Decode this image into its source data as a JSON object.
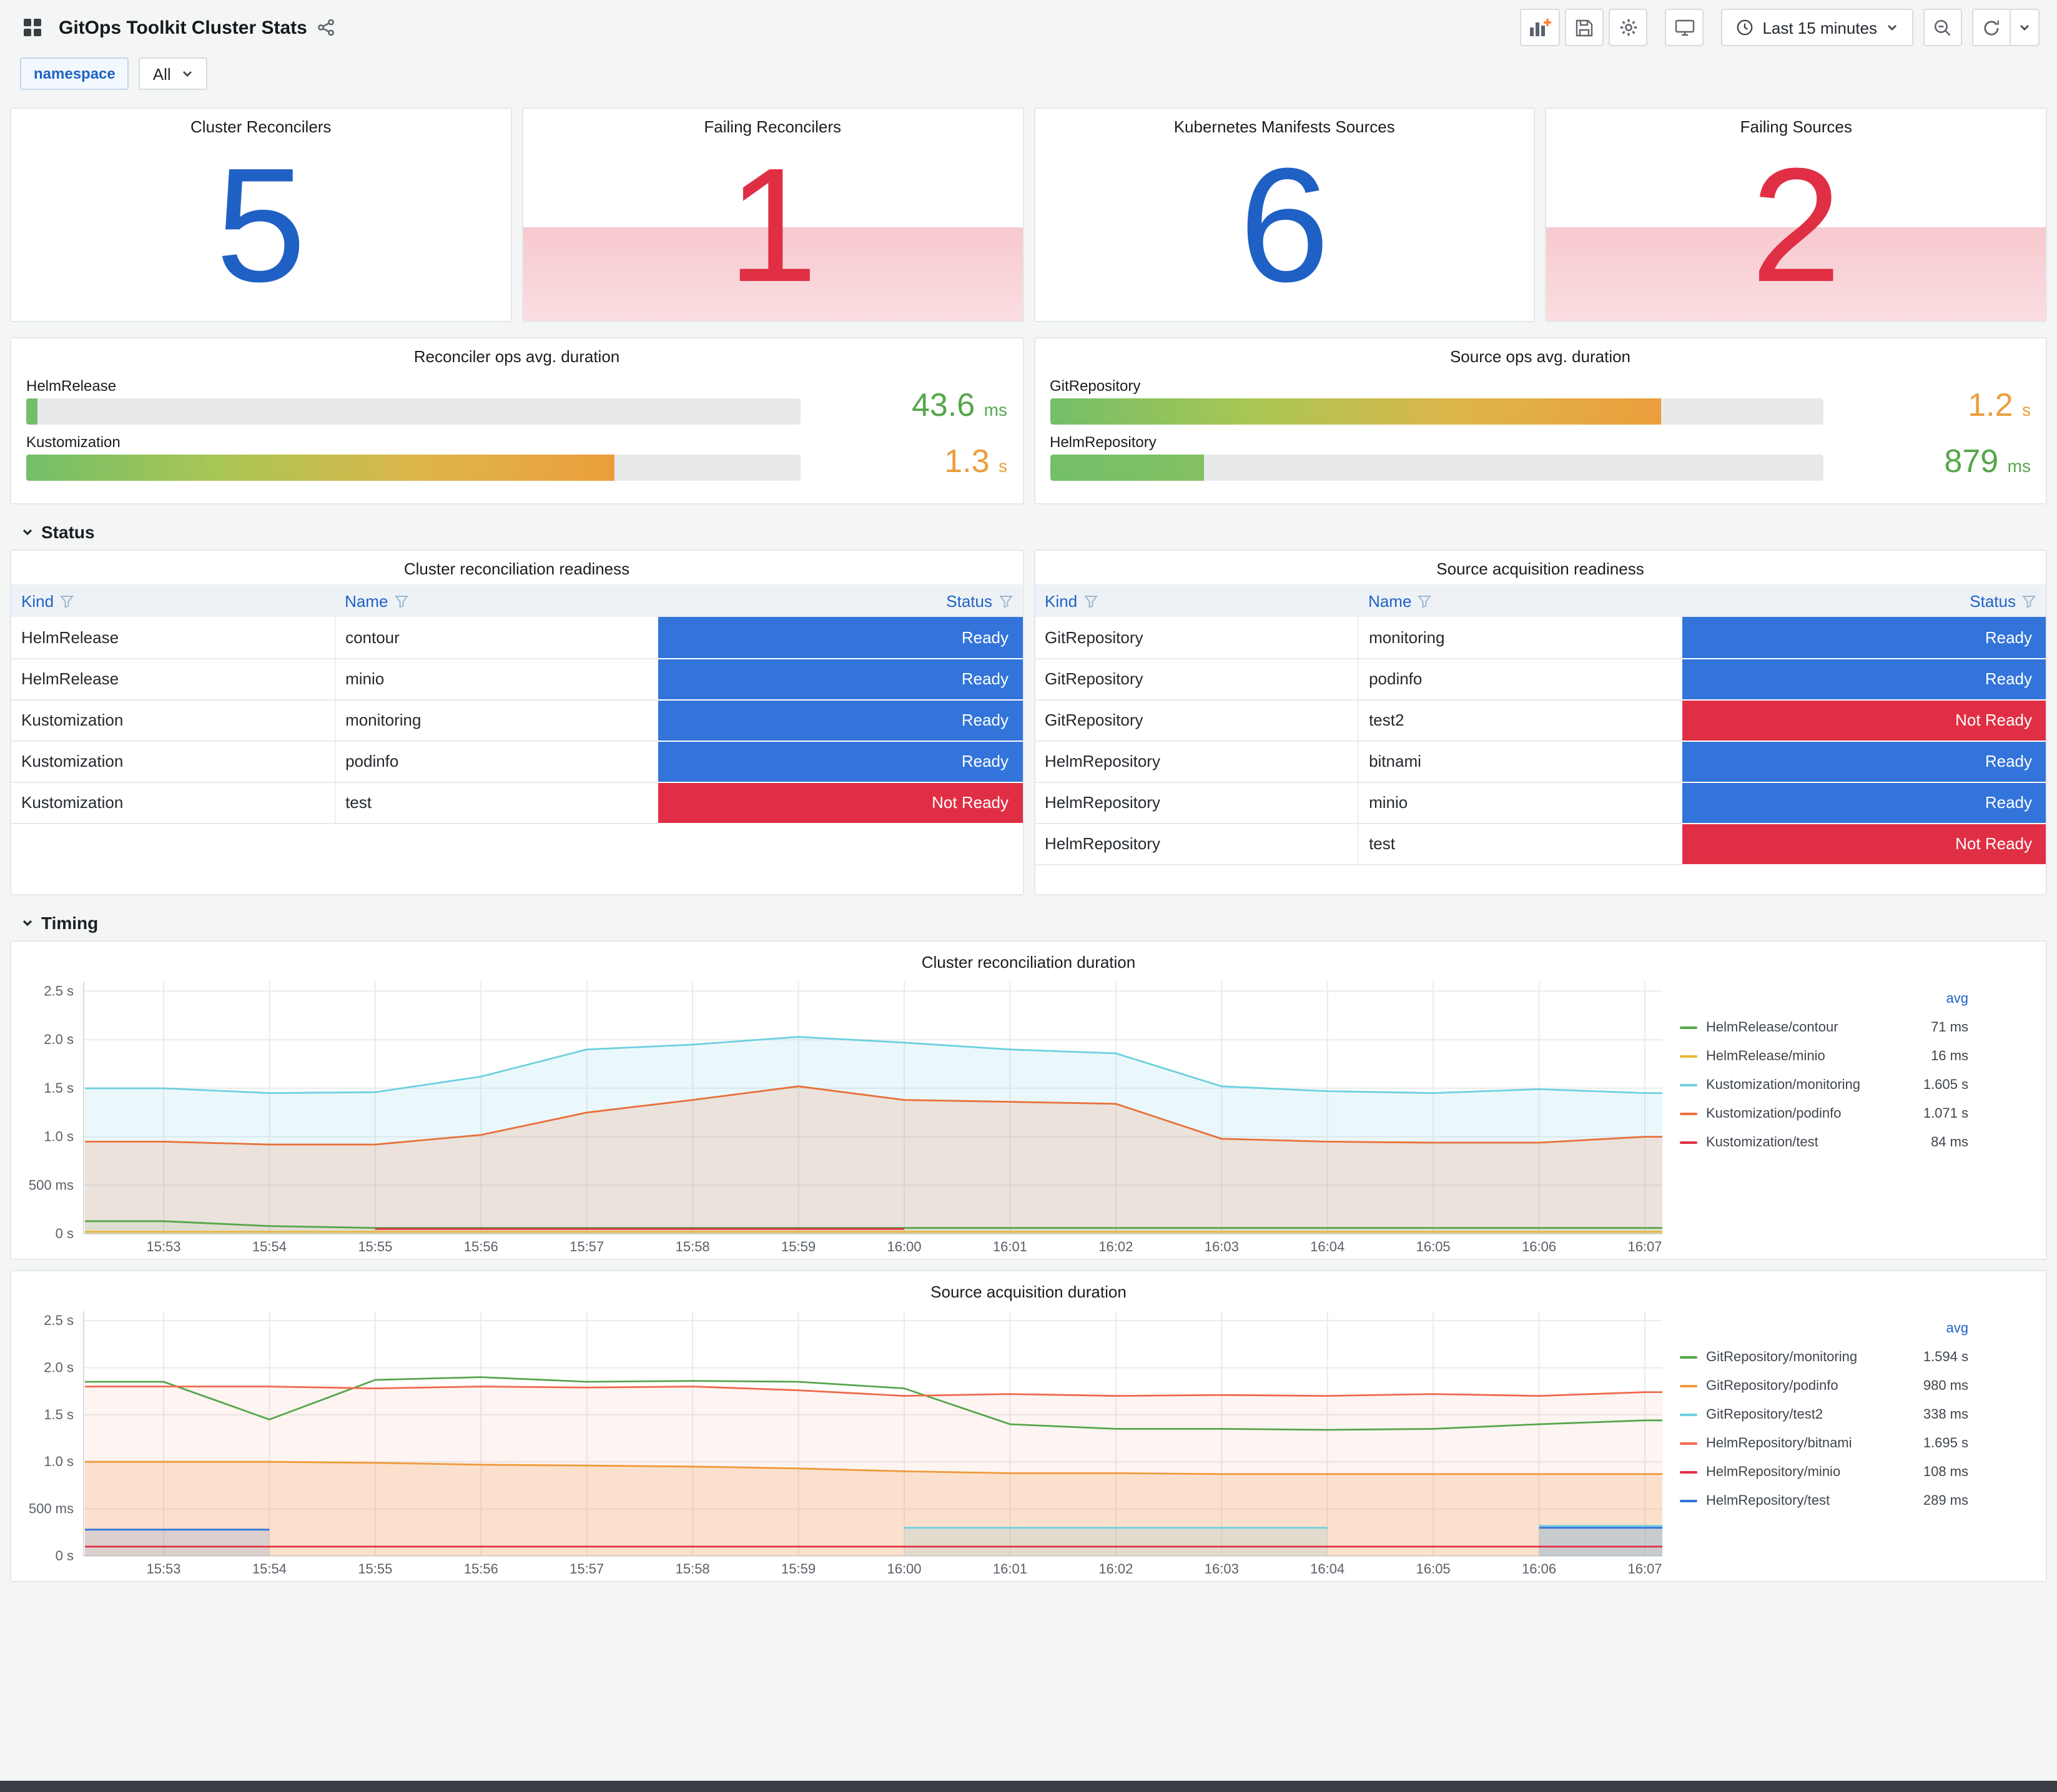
{
  "colors": {
    "blue": "#1F60C4",
    "red": "#E02F44",
    "green": "#56A64B",
    "orange": "#EB9E3C",
    "ready": "#3274D9",
    "not_ready": "#E02F44",
    "link": "#1F62C4"
  },
  "header": {
    "title": "GitOps Toolkit Cluster Stats",
    "time_picker": "Last 15 minutes"
  },
  "variables": {
    "label": "namespace",
    "value": "All"
  },
  "sections": {
    "status": "Status",
    "timing": "Timing"
  },
  "stats": [
    {
      "title": "Cluster Reconcilers",
      "value": "5",
      "color": "#1F60C4",
      "alert": false
    },
    {
      "title": "Failing Reconcilers",
      "value": "1",
      "color": "#E02F44",
      "alert": true
    },
    {
      "title": "Kubernetes Manifests Sources",
      "value": "6",
      "color": "#1F60C4",
      "alert": false
    },
    {
      "title": "Failing Sources",
      "value": "2",
      "color": "#E02F44",
      "alert": true
    }
  ],
  "gauges": [
    {
      "title": "Reconciler ops avg. duration",
      "rows": [
        {
          "label": "HelmRelease",
          "value": "43.6",
          "unit": "ms",
          "pct": 1.5,
          "value_color": "#56A64B",
          "bar_colors": [
            "#73BF69",
            "#73BF69"
          ]
        },
        {
          "label": "Kustomization",
          "value": "1.3",
          "unit": "s",
          "pct": 76,
          "value_color": "#EB9E3C",
          "bar_colors": [
            "#73BF69",
            "#AAC654",
            "#DDB64B",
            "#EB9E3C"
          ]
        }
      ]
    },
    {
      "title": "Source ops avg. duration",
      "rows": [
        {
          "label": "GitRepository",
          "value": "1.2",
          "unit": "s",
          "pct": 79,
          "value_color": "#EB9E3C",
          "bar_colors": [
            "#73BF69",
            "#AAC654",
            "#DDB64B",
            "#EB9E3C"
          ]
        },
        {
          "label": "HelmRepository",
          "value": "879",
          "unit": "ms",
          "pct": 20,
          "value_color": "#56A64B",
          "bar_colors": [
            "#73BF69",
            "#84C163"
          ]
        }
      ]
    }
  ],
  "tables": [
    {
      "title": "Cluster reconciliation readiness",
      "columns": [
        "Kind",
        "Name",
        "Status"
      ],
      "rows": [
        [
          "HelmRelease",
          "contour",
          "Ready"
        ],
        [
          "HelmRelease",
          "minio",
          "Ready"
        ],
        [
          "Kustomization",
          "monitoring",
          "Ready"
        ],
        [
          "Kustomization",
          "podinfo",
          "Ready"
        ],
        [
          "Kustomization",
          "test",
          "Not Ready"
        ]
      ]
    },
    {
      "title": "Source acquisition readiness",
      "columns": [
        "Kind",
        "Name",
        "Status"
      ],
      "rows": [
        [
          "GitRepository",
          "monitoring",
          "Ready"
        ],
        [
          "GitRepository",
          "podinfo",
          "Ready"
        ],
        [
          "GitRepository",
          "test2",
          "Not Ready"
        ],
        [
          "HelmRepository",
          "bitnami",
          "Ready"
        ],
        [
          "HelmRepository",
          "minio",
          "Ready"
        ],
        [
          "HelmRepository",
          "test",
          "Not Ready"
        ]
      ]
    }
  ],
  "chart_data": [
    {
      "type": "line",
      "title": "Cluster reconciliation duration",
      "legend_header": "avg",
      "ylim": [
        0,
        2.6
      ],
      "y_ticks": [
        {
          "v": 0,
          "label": "0 s"
        },
        {
          "v": 0.5,
          "label": "500 ms"
        },
        {
          "v": 1,
          "label": "1.0 s"
        },
        {
          "v": 1.5,
          "label": "1.5 s"
        },
        {
          "v": 2,
          "label": "2.0 s"
        },
        {
          "v": 2.5,
          "label": "2.5 s"
        }
      ],
      "x": [
        "15:53",
        "15:54",
        "15:55",
        "15:56",
        "15:57",
        "15:58",
        "15:59",
        "16:00",
        "16:01",
        "16:02",
        "16:03",
        "16:04",
        "16:05",
        "16:06",
        "16:07"
      ],
      "series": [
        {
          "name": "HelmRelease/contour",
          "avg": "71 ms",
          "color": "#56A64B",
          "fill_opacity": 0.08,
          "values": [
            0.13,
            0.08,
            0.06,
            0.06,
            0.06,
            0.06,
            0.06,
            0.06,
            0.06,
            0.06,
            0.06,
            0.06,
            0.06,
            0.06,
            0.06
          ]
        },
        {
          "name": "HelmRelease/minio",
          "avg": "16 ms",
          "color": "#EAB839",
          "fill_opacity": 0,
          "values": [
            0.02,
            0.02,
            0.02,
            0.02,
            0.02,
            0.02,
            0.02,
            0.02,
            0.02,
            0.02,
            0.02,
            0.02,
            0.02,
            0.02,
            0.02
          ]
        },
        {
          "name": "Kustomization/monitoring",
          "avg": "1.605 s",
          "color": "#6ED0E0",
          "fill_opacity": 0.14,
          "values": [
            1.5,
            1.45,
            1.46,
            1.62,
            1.9,
            1.95,
            2.03,
            1.97,
            1.9,
            1.86,
            1.52,
            1.47,
            1.45,
            1.49,
            1.45
          ]
        },
        {
          "name": "Kustomization/podinfo",
          "avg": "1.071 s",
          "color": "#E8703A",
          "fill_opacity": 0.16,
          "values": [
            0.95,
            0.92,
            0.92,
            1.02,
            1.25,
            1.38,
            1.52,
            1.38,
            1.36,
            1.34,
            0.98,
            0.95,
            0.94,
            0.94,
            1.0
          ]
        },
        {
          "name": "Kustomization/test",
          "avg": "84 ms",
          "color": "#E02F44",
          "fill_opacity": 0,
          "values": [
            null,
            null,
            0.05,
            0.05,
            0.05,
            0.05,
            0.05,
            0.05,
            null,
            null,
            null,
            null,
            null,
            null,
            null
          ]
        }
      ]
    },
    {
      "type": "line",
      "title": "Source acquisition duration",
      "legend_header": "avg",
      "ylim": [
        0,
        2.6
      ],
      "y_ticks": [
        {
          "v": 0,
          "label": "0 s"
        },
        {
          "v": 0.5,
          "label": "500 ms"
        },
        {
          "v": 1,
          "label": "1.0 s"
        },
        {
          "v": 1.5,
          "label": "1.5 s"
        },
        {
          "v": 2,
          "label": "2.0 s"
        },
        {
          "v": 2.5,
          "label": "2.5 s"
        }
      ],
      "x": [
        "15:53",
        "15:54",
        "15:55",
        "15:56",
        "15:57",
        "15:58",
        "15:59",
        "16:00",
        "16:01",
        "16:02",
        "16:03",
        "16:04",
        "16:05",
        "16:06",
        "16:07"
      ],
      "series": [
        {
          "name": "GitRepository/monitoring",
          "avg": "1.594 s",
          "color": "#56A64B",
          "fill_opacity": 0,
          "values": [
            1.85,
            1.45,
            1.87,
            1.9,
            1.85,
            1.86,
            1.85,
            1.78,
            1.4,
            1.35,
            1.35,
            1.34,
            1.35,
            1.4,
            1.44
          ]
        },
        {
          "name": "GitRepository/podinfo",
          "avg": "980 ms",
          "color": "#EF9A3C",
          "fill_opacity": 0.2,
          "values": [
            1.0,
            1.0,
            0.99,
            0.97,
            0.96,
            0.95,
            0.93,
            0.9,
            0.88,
            0.88,
            0.87,
            0.87,
            0.87,
            0.87,
            0.87
          ]
        },
        {
          "name": "GitRepository/test2",
          "avg": "338 ms",
          "color": "#6ED0E0",
          "fill_opacity": 0.18,
          "values": [
            null,
            null,
            null,
            null,
            null,
            null,
            null,
            0.3,
            0.3,
            0.3,
            0.3,
            0.3,
            null,
            0.32,
            0.32
          ]
        },
        {
          "name": "HelmRepository/bitnami",
          "avg": "1.695 s",
          "color": "#EF6A4C",
          "fill_opacity": 0.07,
          "values": [
            1.8,
            1.8,
            1.78,
            1.8,
            1.79,
            1.8,
            1.76,
            1.7,
            1.72,
            1.7,
            1.71,
            1.7,
            1.72,
            1.7,
            1.74
          ]
        },
        {
          "name": "HelmRepository/minio",
          "avg": "108 ms",
          "color": "#E02F44",
          "fill_opacity": 0,
          "values": [
            0.1,
            0.1,
            0.1,
            0.1,
            0.1,
            0.1,
            0.1,
            0.1,
            0.1,
            0.1,
            0.1,
            0.1,
            0.1,
            0.1,
            0.1
          ]
        },
        {
          "name": "HelmRepository/test",
          "avg": "289 ms",
          "color": "#3274D9",
          "fill_opacity": 0.15,
          "values": [
            0.28,
            0.28,
            null,
            null,
            null,
            null,
            null,
            null,
            null,
            null,
            null,
            null,
            null,
            0.3,
            0.3
          ]
        }
      ]
    }
  ]
}
